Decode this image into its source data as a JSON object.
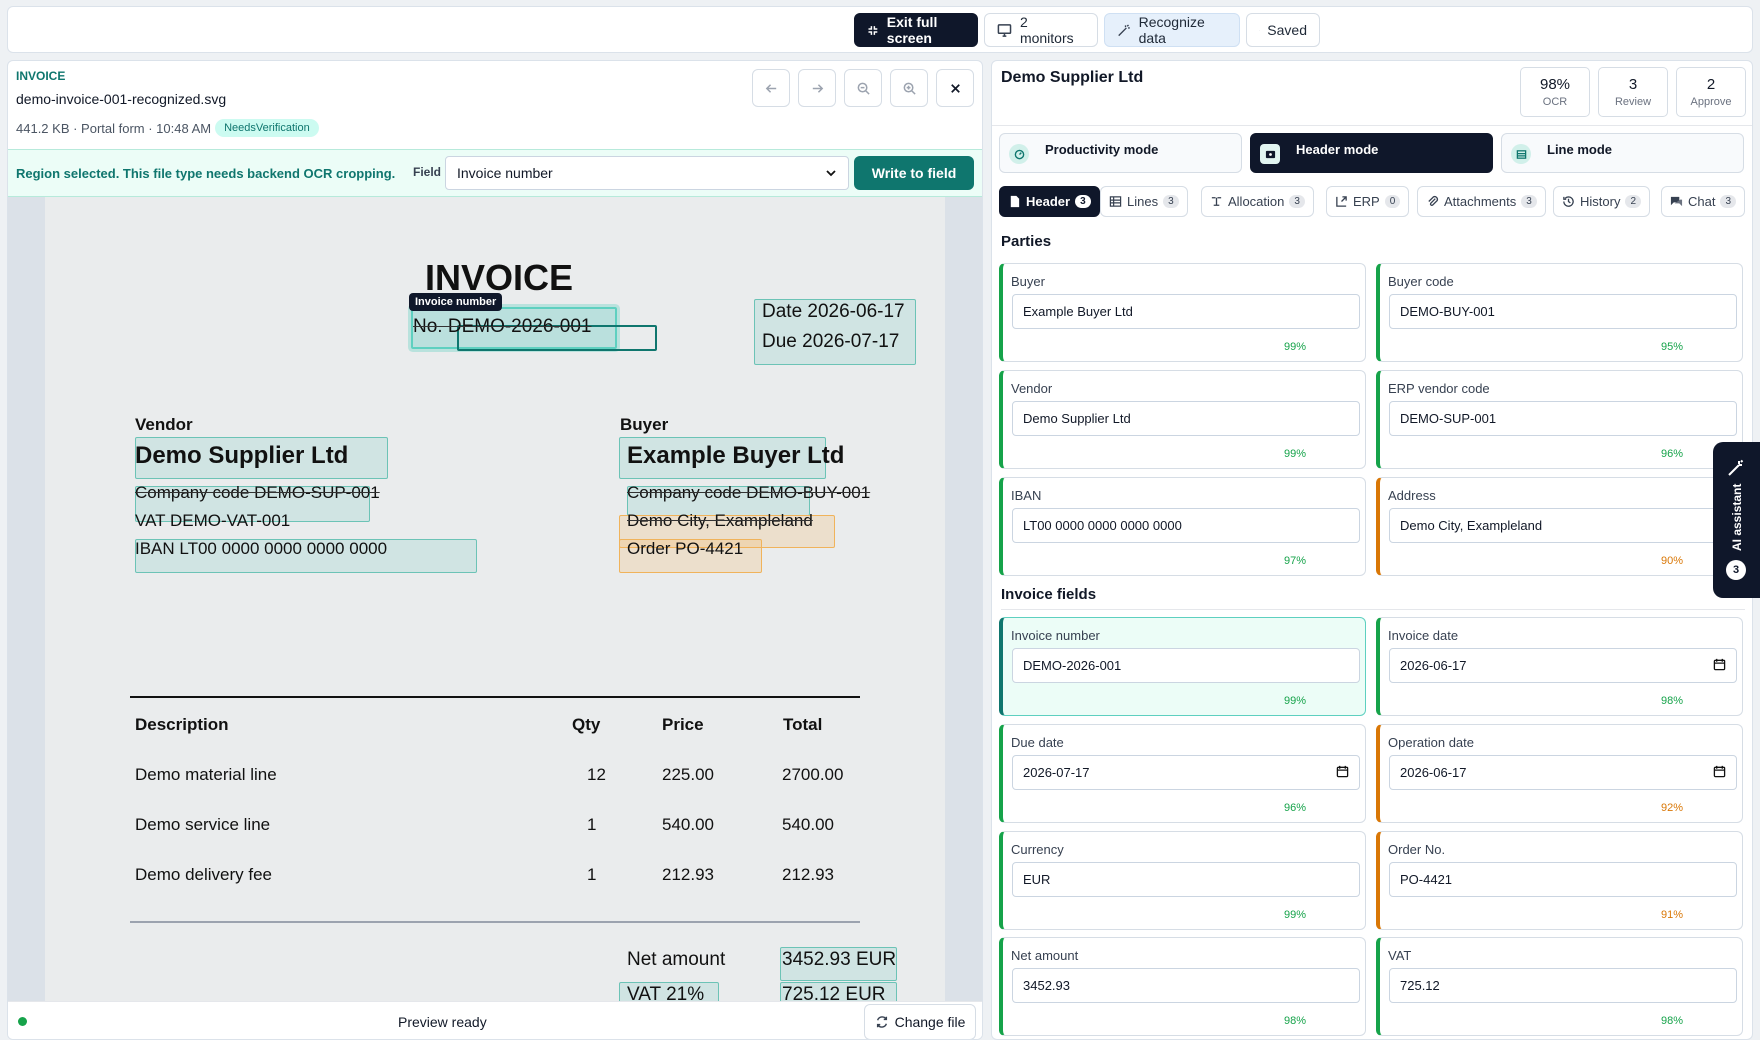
{
  "topbar": {
    "exit_full_screen": "Exit full screen",
    "monitors": "2 monitors",
    "recognize_data": "Recognize data",
    "saved": "Saved"
  },
  "viewer": {
    "doc_type": "INVOICE",
    "file_name": "demo-invoice-001-recognized.svg",
    "file_meta": "441.2 KB · Portal form · 10:48 AM",
    "status_badge": "NeedsVerification",
    "region_message": "Region selected. This file type needs backend OCR cropping.",
    "field_label": "Field",
    "field_value": "Invoice number",
    "write_button": "Write to field",
    "footer_status": "Preview ready",
    "change_file": "Change file"
  },
  "document": {
    "title": "INVOICE",
    "tooltip": "Invoice number",
    "number_line": "No. DEMO-2026-001",
    "date_line": "Date 2026-06-17",
    "due_line": "Due 2026-07-17",
    "vendor_heading": "Vendor",
    "vendor_name": "Demo Supplier Ltd",
    "vendor_code": "Company code DEMO-SUP-001",
    "vendor_vat": "VAT DEMO-VAT-001",
    "vendor_iban": "IBAN LT00 0000 0000 0000 0000",
    "buyer_heading": "Buyer",
    "buyer_name": "Example Buyer Ltd",
    "buyer_code": "Company code DEMO-BUY-001",
    "buyer_address": "Demo City, Exampleland",
    "buyer_order": "Order PO-4421",
    "table_headers": [
      "Description",
      "Qty",
      "Price",
      "Total"
    ],
    "rows": [
      [
        "Demo material line",
        "12",
        "225.00",
        "2700.00"
      ],
      [
        "Demo service line",
        "1",
        "540.00",
        "540.00"
      ],
      [
        "Demo delivery fee",
        "1",
        "212.93",
        "212.93"
      ]
    ],
    "net_label": "Net amount",
    "net_value": "3452.93 EUR",
    "vat_label": "VAT 21%",
    "vat_value": "725.12 EUR"
  },
  "panel": {
    "supplier": "Demo Supplier Ltd",
    "stats": [
      {
        "value": "98%",
        "label": "OCR"
      },
      {
        "value": "3",
        "label": "Review"
      },
      {
        "value": "2",
        "label": "Approve"
      }
    ],
    "modes": [
      "Productivity mode",
      "Header mode",
      "Line mode"
    ],
    "tabs": [
      {
        "label": "Header",
        "count": "3"
      },
      {
        "label": "Lines",
        "count": "3"
      },
      {
        "label": "Allocation",
        "count": "3"
      },
      {
        "label": "ERP",
        "count": "0"
      },
      {
        "label": "Attachments",
        "count": "3"
      },
      {
        "label": "History",
        "count": "2"
      },
      {
        "label": "Chat",
        "count": "3"
      }
    ],
    "parties_title": "Parties",
    "invoice_fields_title": "Invoice fields",
    "parties": [
      {
        "label": "Buyer",
        "value": "Example Buyer Ltd",
        "conf": "99%"
      },
      {
        "label": "Buyer code",
        "value": "DEMO-BUY-001",
        "conf": "95%"
      },
      {
        "label": "Vendor",
        "value": "Demo Supplier Ltd",
        "conf": "99%"
      },
      {
        "label": "ERP vendor code",
        "value": "DEMO-SUP-001",
        "conf": "96%"
      },
      {
        "label": "IBAN",
        "value": "LT00 0000 0000 0000 0000",
        "conf": "97%"
      },
      {
        "label": "Address",
        "value": "Demo City, Exampleland",
        "conf": "90%"
      }
    ],
    "fields": [
      {
        "label": "Invoice number",
        "value": "DEMO-2026-001",
        "conf": "99%"
      },
      {
        "label": "Invoice date",
        "value": "2026-06-17",
        "conf": "98%"
      },
      {
        "label": "Due date",
        "value": "2026-07-17",
        "conf": "96%"
      },
      {
        "label": "Operation date",
        "value": "2026-06-17",
        "conf": "92%"
      },
      {
        "label": "Currency",
        "value": "EUR",
        "conf": "99%"
      },
      {
        "label": "Order No.",
        "value": "PO-4421",
        "conf": "91%"
      },
      {
        "label": "Net amount",
        "value": "3452.93",
        "conf": "98%"
      },
      {
        "label": "VAT",
        "value": "725.12",
        "conf": "98%"
      }
    ]
  },
  "ai_assistant": {
    "label": "AI assistant",
    "count": "3"
  },
  "colors": {
    "accent": "#0f766e",
    "dark": "#0f172a",
    "ok": "#16a34a",
    "warn": "#d97706"
  }
}
